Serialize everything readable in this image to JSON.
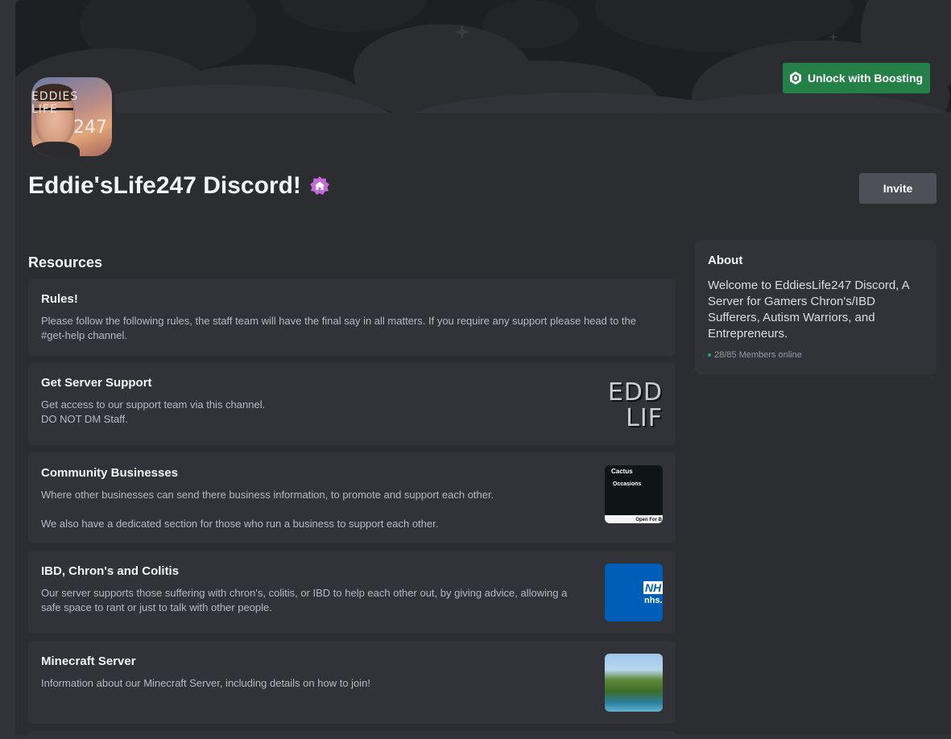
{
  "server": {
    "name": "Eddie'sLife247 Discord!",
    "avatar_text_top": "EDDIES LIFE",
    "avatar_text_bottom": "247"
  },
  "buttons": {
    "boost_label": "Unlock with Boosting",
    "invite_label": "Invite"
  },
  "resources": {
    "heading": "Resources",
    "items": [
      {
        "title": "Rules!",
        "description": "Please follow the following rules, the staff team will have the final say in all matters. If you require any support please head to the #get-help channel."
      },
      {
        "title": "Get Server Support",
        "description": "Get access to our support team via this channel.\nDO NOT DM Staff.",
        "thumb_line1": "EDD",
        "thumb_line2": "LIF"
      },
      {
        "title": "Community Businesses",
        "description": "Where other businesses can send there business information, to promote and support each other.\n\nWe also have a dedicated section for those who run a business to support each other.",
        "thumb_top": "Cactus",
        "thumb_mid": "Occasions",
        "thumb_bottom": "Open For B"
      },
      {
        "title": "IBD, Chron's and Colitis",
        "description": "Our server supports those suffering with chron's, colitis, or IBD to help each other out, by giving advice, allowing a safe space to rant or just to talk with other people.",
        "thumb_logo": "NH",
        "thumb_url": "nhs.u"
      },
      {
        "title": "Minecraft Server",
        "description": "Information about our Minecraft Server, including details on how to join!"
      }
    ]
  },
  "about": {
    "title": "About",
    "text": "Welcome to EddiesLife247 Discord, A Server for Gamers Chron's/IBD Sufferers, Autism Warriors, and Entrepreneurs.",
    "online": "28/85 Members online"
  },
  "colors": {
    "accent_green": "#248046",
    "online_green": "#23a55a",
    "home_badge": "#c46ad8"
  }
}
